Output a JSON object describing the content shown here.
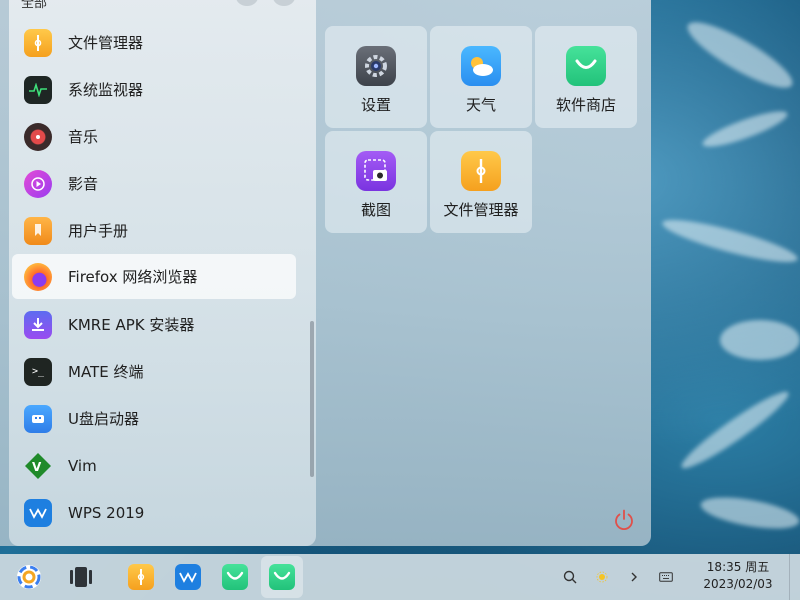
{
  "menu": {
    "header_title": "全部",
    "apps": [
      {
        "label": "文件管理器",
        "icon": "file-manager-icon",
        "selected": false
      },
      {
        "label": "系统监视器",
        "icon": "system-monitor-icon",
        "selected": false
      },
      {
        "label": "音乐",
        "icon": "music-icon",
        "selected": false
      },
      {
        "label": "影音",
        "icon": "video-player-icon",
        "selected": false
      },
      {
        "label": "用户手册",
        "icon": "user-manual-icon",
        "selected": false
      },
      {
        "label": "Firefox 网络浏览器",
        "icon": "firefox-icon",
        "selected": true
      },
      {
        "label": "KMRE APK 安装器",
        "icon": "apk-installer-icon",
        "selected": false
      },
      {
        "label": "MATE 终端",
        "icon": "terminal-icon",
        "selected": false
      },
      {
        "label": "U盘启动器",
        "icon": "usb-boot-icon",
        "selected": false
      },
      {
        "label": "Vim",
        "icon": "vim-icon",
        "selected": false
      },
      {
        "label": "WPS 2019",
        "icon": "wps-icon",
        "selected": false
      }
    ],
    "favorites": [
      {
        "label": "设置",
        "icon": "settings-icon"
      },
      {
        "label": "天气",
        "icon": "weather-icon"
      },
      {
        "label": "软件商店",
        "icon": "software-store-icon"
      },
      {
        "label": "截图",
        "icon": "screenshot-icon"
      },
      {
        "label": "文件管理器",
        "icon": "file-manager-icon"
      }
    ]
  },
  "taskbar": {
    "clock_time": "18:35 周五",
    "clock_date": "2023/02/03",
    "colors": {
      "accent_orange": "#f5a623",
      "power_red": "#e0504a",
      "store_green": "#2fd18a",
      "wps_blue": "#1e7fe0"
    }
  }
}
